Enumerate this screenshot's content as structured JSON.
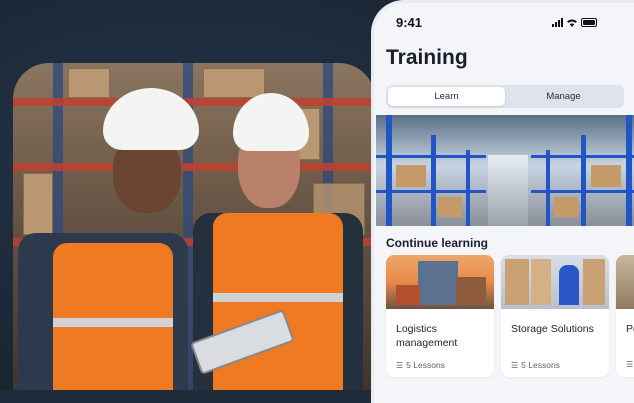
{
  "status_bar": {
    "time": "9:41"
  },
  "page": {
    "title": "Training"
  },
  "tabs": [
    {
      "label": "Learn",
      "active": true
    },
    {
      "label": "Manage",
      "active": false
    }
  ],
  "section": {
    "title": "Continue learning"
  },
  "courses": [
    {
      "name": "Logistics management",
      "lessons": "5 Lessons"
    },
    {
      "name": "Storage Solutions",
      "lessons": "5 Lessons"
    },
    {
      "name": "Pe",
      "lessons": ""
    }
  ],
  "colors": {
    "accent": "#f07a22",
    "phone_bg": "#f4f5f9",
    "page_bg": "#1e2b3a"
  }
}
